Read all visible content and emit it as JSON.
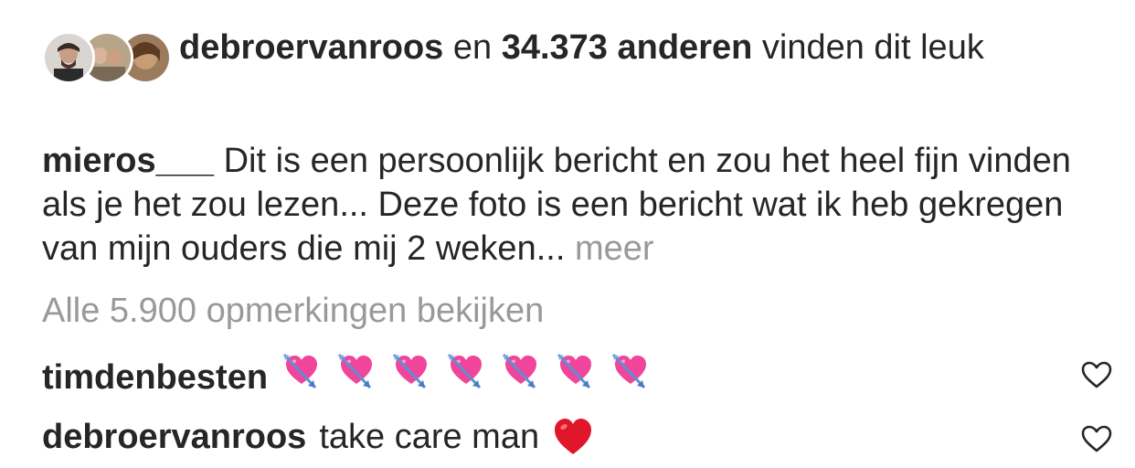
{
  "likes": {
    "user": "debroervanroos",
    "connector": "en",
    "others": "34.373 anderen",
    "suffix": "vinden dit leuk"
  },
  "caption": {
    "user": "mieros___",
    "text": "Dit is een persoonlijk bericht en zou het heel fijn vinden als je het zou lezen... Deze foto is een bericht wat ik heb gekregen van mijn ouders die mij 2 weken...",
    "more": "meer"
  },
  "view_all_comments": "Alle 5.900 opmerkingen bekijken",
  "comments": [
    {
      "user": "timdenbesten",
      "text": "",
      "emoji": "heart-with-arrow-icon",
      "emoji_count": 7
    },
    {
      "user": "debroervanroos",
      "text": "take care man",
      "emoji": "red-heart-icon"
    }
  ],
  "colors": {
    "text": "#262626",
    "muted": "#999999",
    "heart_pink": "#f0459a",
    "heart_red": "#e0172b"
  }
}
